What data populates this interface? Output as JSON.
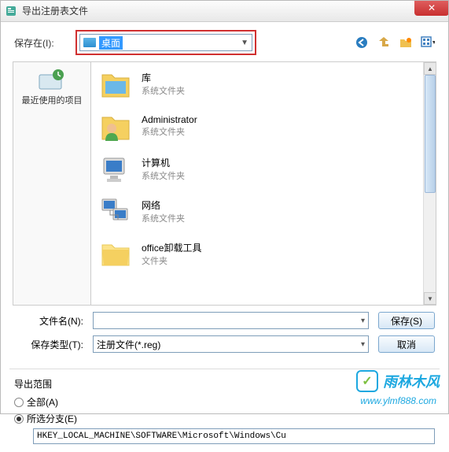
{
  "titlebar": {
    "title": "导出注册表文件",
    "close": "✕"
  },
  "toolbar": {
    "save_in_label": "保存在(I):",
    "location": "桌面",
    "dropdown_arrow": "▼"
  },
  "places": {
    "recent": "最近使用的项目"
  },
  "files": [
    {
      "name": "库",
      "type": "系统文件夹",
      "icon": "library"
    },
    {
      "name": "Administrator",
      "type": "系统文件夹",
      "icon": "user"
    },
    {
      "name": "计算机",
      "type": "系统文件夹",
      "icon": "computer"
    },
    {
      "name": "网络",
      "type": "系统文件夹",
      "icon": "network"
    },
    {
      "name": "office卸载工具",
      "type": "文件夹",
      "icon": "folder"
    }
  ],
  "fields": {
    "filename_label": "文件名(N):",
    "filename_value": "",
    "filetype_label": "保存类型(T):",
    "filetype_value": "注册文件(*.reg)",
    "save_btn": "保存(S)",
    "cancel_btn": "取消"
  },
  "export": {
    "title": "导出范围",
    "all_label": "全部(A)",
    "branch_label": "所选分支(E)",
    "branch_value": "HKEY_LOCAL_MACHINE\\SOFTWARE\\Microsoft\\Windows\\Cu"
  },
  "watermark": {
    "text": "雨林木风",
    "url": "www.ylmf888.com",
    "badge": "✓"
  }
}
